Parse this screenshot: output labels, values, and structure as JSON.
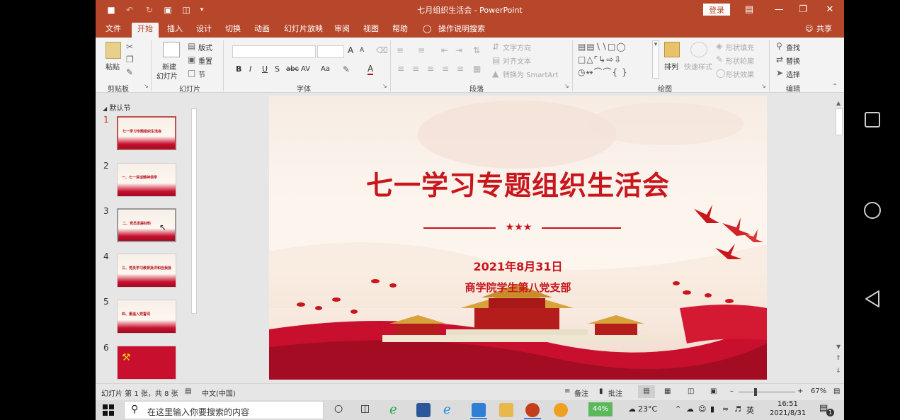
{
  "window": {
    "title": "七月组织生活会 - PowerPoint",
    "login_label": "登录",
    "share_label": "共享"
  },
  "menu": {
    "tabs": [
      "文件",
      "开始",
      "插入",
      "设计",
      "切换",
      "动画",
      "幻灯片放映",
      "审阅",
      "视图",
      "帮助"
    ],
    "active_tab": "开始",
    "tell_me": "操作说明搜索"
  },
  "ribbon": {
    "clipboard": {
      "paste": "粘贴",
      "group": "剪贴板"
    },
    "slides": {
      "new_slide_line1": "新建",
      "new_slide_line2": "幻灯片",
      "layout": "版式",
      "reset": "重置",
      "section": "节",
      "group": "幻灯片"
    },
    "font": {
      "bold": "B",
      "italic": "I",
      "underline": "U",
      "shadow": "S",
      "strike": "abc",
      "spacing": "AV",
      "case": "Aa",
      "color": "A",
      "grow": "A",
      "shrink": "A",
      "group": "字体"
    },
    "paragraph": {
      "text_direction": "文字方向",
      "align_text": "对齐文本",
      "smartart": "转换为 SmartArt",
      "group": "段落"
    },
    "drawing": {
      "arrange": "排列",
      "quick_styles": "快速样式",
      "fill": "形状填充",
      "outline": "形状轮廓",
      "effects": "形状效果",
      "group": "绘图"
    },
    "editing": {
      "find": "查找",
      "replace": "替换",
      "select": "选择",
      "group": "编辑"
    }
  },
  "thumbnails": {
    "section": "默认节",
    "slides": [
      {
        "num": "1",
        "label": "七一学习专题组织生活会"
      },
      {
        "num": "2",
        "label": "一、七一讲话精神领学"
      },
      {
        "num": "3",
        "label": "二、党员发展材料"
      },
      {
        "num": "4",
        "label": "三、党员学习教育批评和自我批评"
      },
      {
        "num": "5",
        "label": "四、重温入党誓词"
      },
      {
        "num": "6",
        "label": ""
      }
    ]
  },
  "slide": {
    "title": "七一学习专题组织生活会",
    "stars": "★★★",
    "date": "2021年8月31日",
    "org": "商学院学生第八党支部"
  },
  "statusbar": {
    "slide_info": "幻灯片 第 1 张，共 8 张",
    "language": "中文(中国)",
    "notes": "备注",
    "comments": "批注",
    "zoom": "67%"
  },
  "taskbar": {
    "search_placeholder": "在这里输入你要搜索的内容",
    "battery": "44%",
    "weather": "23°C",
    "ime": "英",
    "time": "16:51",
    "date": "2021/8/31",
    "notif_count": "1"
  },
  "colors": {
    "ppt_accent": "#b7472a",
    "slide_red": "#c8161d"
  }
}
